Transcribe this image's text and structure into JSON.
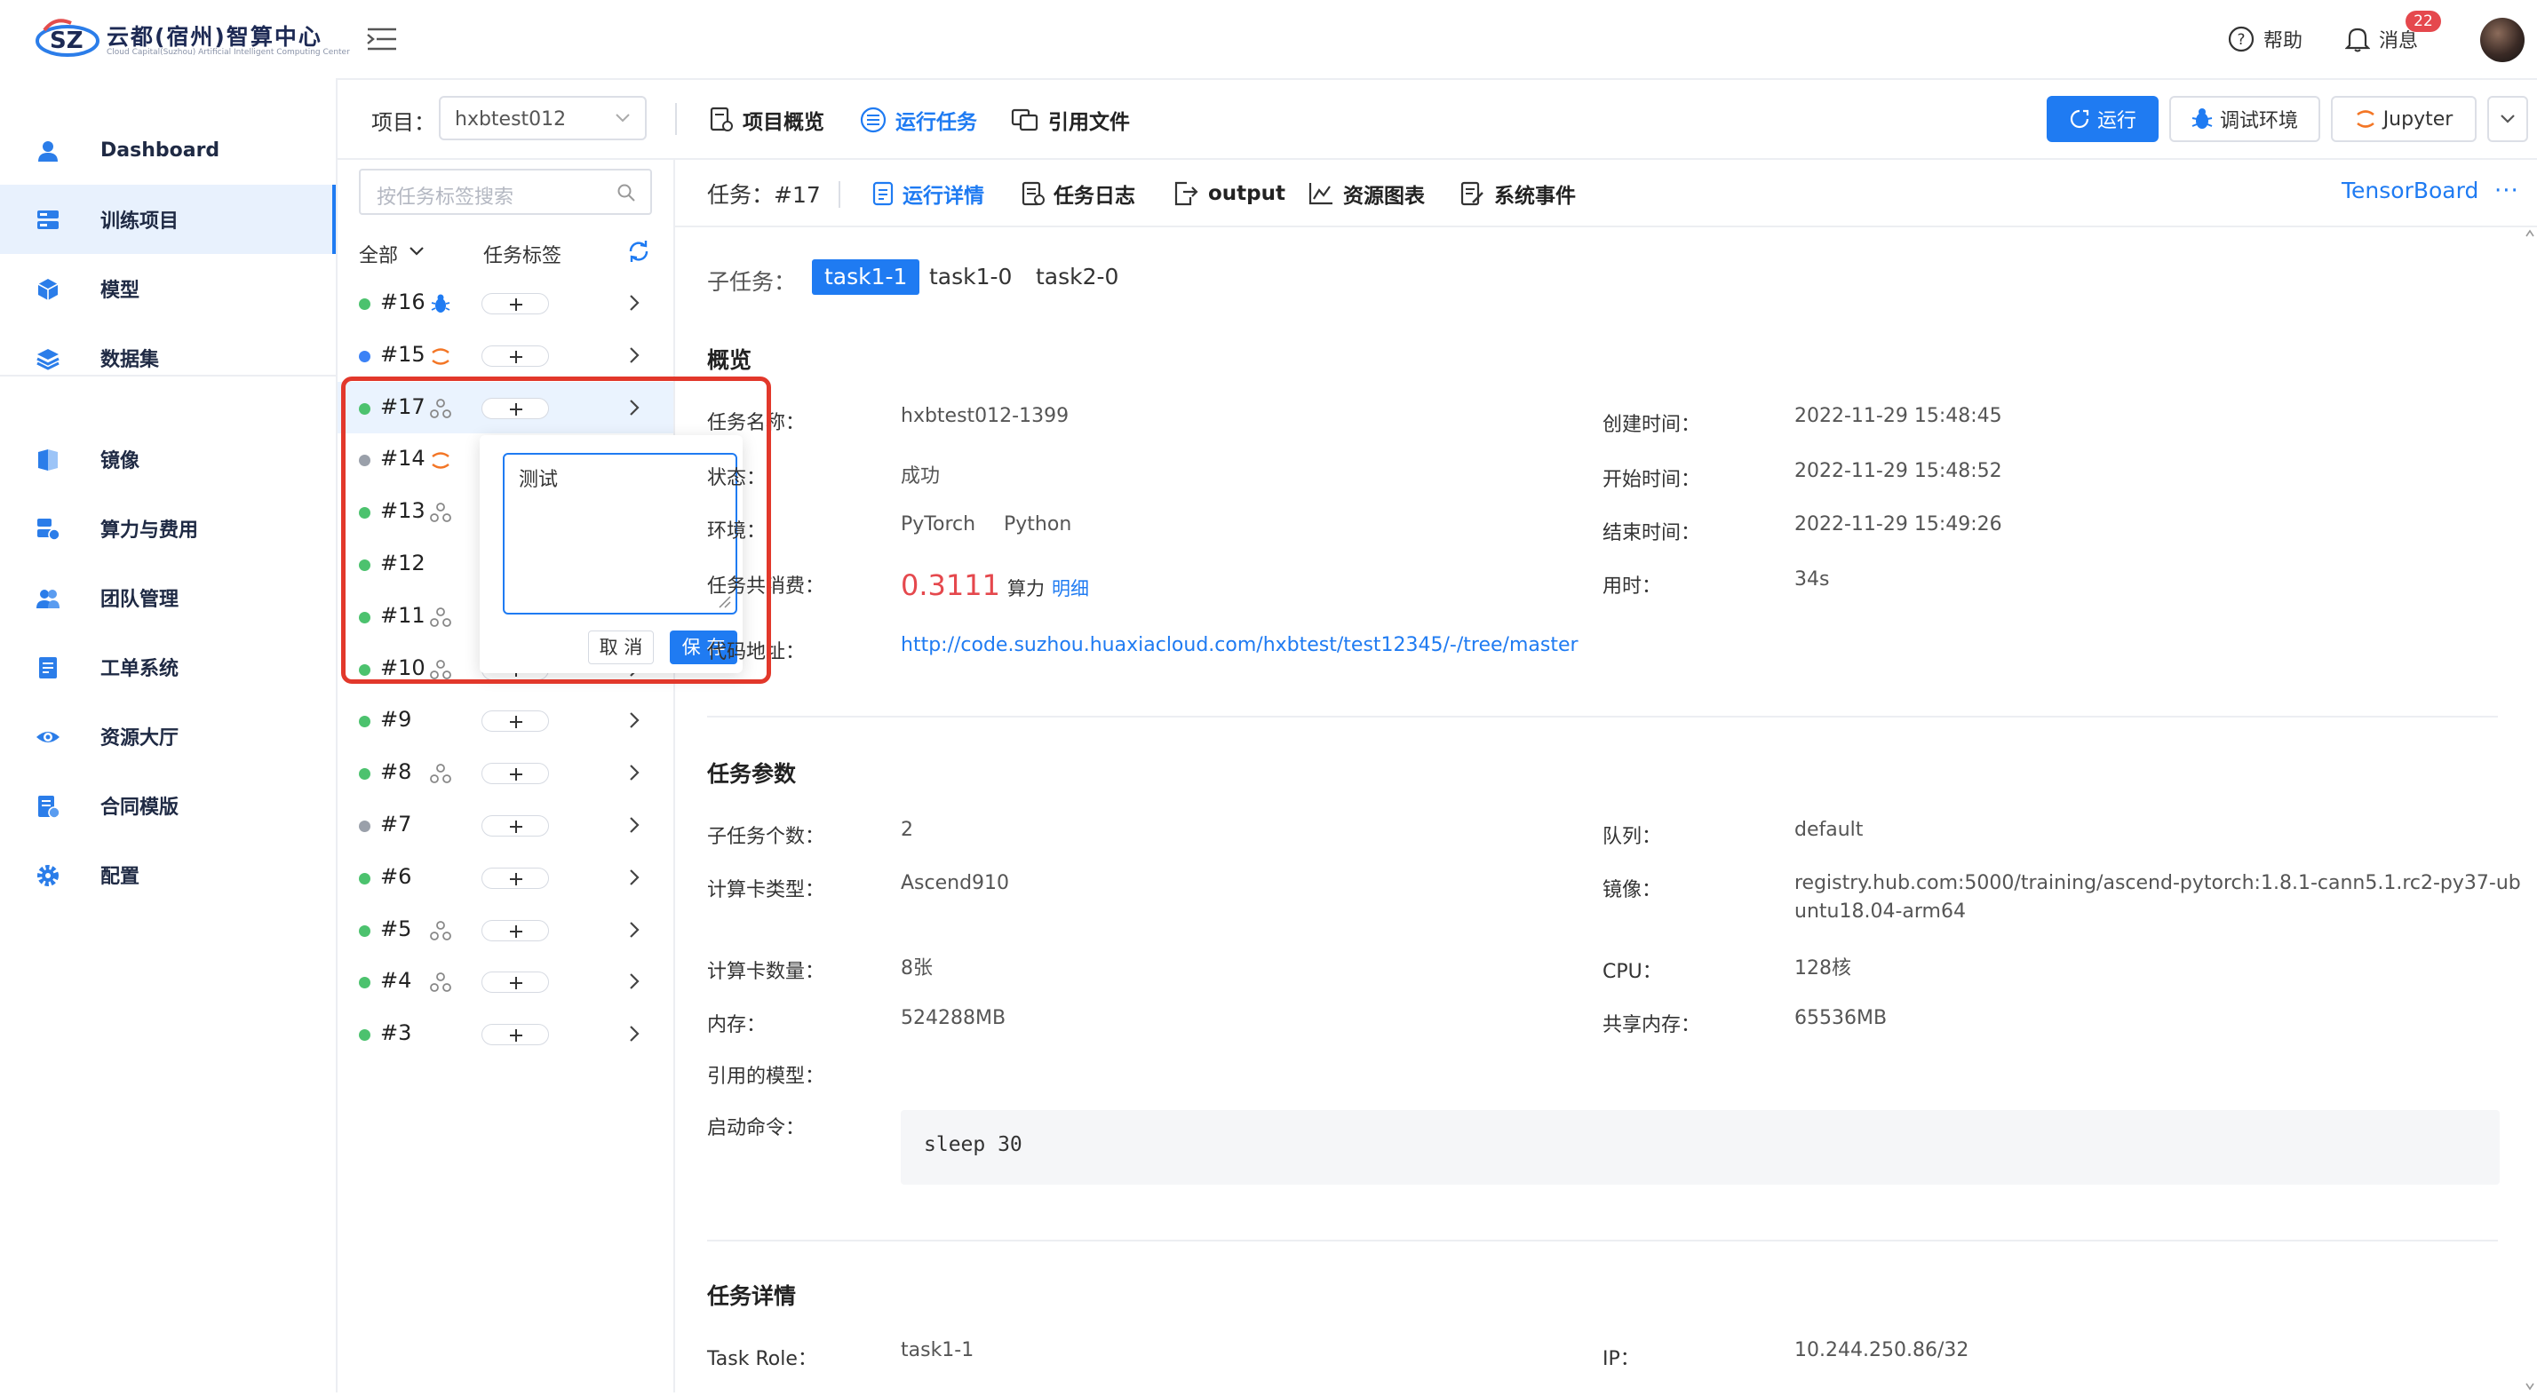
{
  "brand": {
    "name": "云都(宿州)智算中心",
    "subtitle": "Cloud Capital(Suzhou) Artificial Intelligent Computing Center"
  },
  "header": {
    "help": "帮助",
    "messages": "消息",
    "message_count": "22"
  },
  "sidebar": {
    "items": [
      {
        "label": "Dashboard",
        "icon": "user-icon"
      },
      {
        "label": "训练项目",
        "icon": "server-icon",
        "active": true
      },
      {
        "label": "模型",
        "icon": "cube-icon"
      },
      {
        "label": "数据集",
        "icon": "layers-icon"
      },
      {
        "label": "镜像",
        "icon": "mirror-icon"
      },
      {
        "label": "算力与费用",
        "icon": "compute-icon"
      },
      {
        "label": "团队管理",
        "icon": "team-icon"
      },
      {
        "label": "工单系统",
        "icon": "ticket-icon"
      },
      {
        "label": "资源大厅",
        "icon": "eye-icon"
      },
      {
        "label": "合同模版",
        "icon": "contract-icon"
      },
      {
        "label": "配置",
        "icon": "gear-icon"
      }
    ]
  },
  "project": {
    "label": "项目：",
    "selected": "hxbtest012",
    "tabs": [
      {
        "label": "项目概览",
        "icon": "overview-icon"
      },
      {
        "label": "运行任务",
        "icon": "list-icon",
        "active": true
      },
      {
        "label": "引用文件",
        "icon": "files-icon"
      }
    ],
    "actions": {
      "run": "运行",
      "debug_env": "调试环境",
      "jupyter": "Jupyter"
    }
  },
  "tasklist": {
    "search_placeholder": "按任务标签搜索",
    "filter": "全部",
    "tag_header": "任务标签",
    "rows": [
      {
        "id": "#16",
        "status": "green",
        "icon": "bug-icon"
      },
      {
        "id": "#15",
        "status": "blue",
        "icon": "jupyter-icon"
      },
      {
        "id": "#17",
        "status": "green",
        "icon": "distributed-icon",
        "active": true
      },
      {
        "id": "#14",
        "status": "gray",
        "icon": "jupyter-icon"
      },
      {
        "id": "#13",
        "status": "green",
        "icon": "distributed-icon"
      },
      {
        "id": "#12",
        "status": "green",
        "icon": ""
      },
      {
        "id": "#11",
        "status": "green",
        "icon": "distributed-icon"
      },
      {
        "id": "#10",
        "status": "green",
        "icon": "distributed-icon"
      },
      {
        "id": "#9",
        "status": "green",
        "icon": ""
      },
      {
        "id": "#8",
        "status": "green",
        "icon": "distributed-icon"
      },
      {
        "id": "#7",
        "status": "gray",
        "icon": ""
      },
      {
        "id": "#6",
        "status": "green",
        "icon": ""
      },
      {
        "id": "#5",
        "status": "green",
        "icon": "distributed-icon"
      },
      {
        "id": "#4",
        "status": "green",
        "icon": "distributed-icon"
      },
      {
        "id": "#3",
        "status": "green",
        "icon": ""
      }
    ]
  },
  "tag_popover": {
    "value": "测试",
    "cancel": "取 消",
    "save": "保 存"
  },
  "detail": {
    "task_label": "任务：#17",
    "tabs": [
      {
        "label": "运行详情",
        "icon": "detail-icon",
        "active": true
      },
      {
        "label": "任务日志",
        "icon": "log-icon"
      },
      {
        "label": "output",
        "icon": "output-icon"
      },
      {
        "label": "资源图表",
        "icon": "chart-icon"
      },
      {
        "label": "系统事件",
        "icon": "event-icon"
      }
    ],
    "tensorboard": "TensorBoard",
    "more": "···",
    "subtask_label": "子任务：",
    "subtasks": [
      "task1-1",
      "task1-0",
      "task2-0"
    ],
    "overview": {
      "title": "概览",
      "name_label": "任务名称：",
      "name": "hxbtest012-1399",
      "status_label": "状态：",
      "status": "成功",
      "env_label": "环境：",
      "env": [
        "PyTorch",
        "Python"
      ],
      "cost_label": "任务共消费：",
      "cost": "0.3111",
      "cost_unit": "算力",
      "cost_detail": "明细",
      "repo_label": "代码地址：",
      "repo": "http://code.suzhou.huaxiacloud.com/hxbtest/test12345/-/tree/master",
      "created_label": "创建时间：",
      "created": "2022-11-29 15:48:45",
      "started_label": "开始时间：",
      "started": "2022-11-29 15:48:52",
      "ended_label": "结束时间：",
      "ended": "2022-11-29 15:49:26",
      "duration_label": "用时：",
      "duration": "34s"
    },
    "params": {
      "title": "任务参数",
      "subtask_count_label": "子任务个数：",
      "subtask_count": "2",
      "card_type_label": "计算卡类型：",
      "card_type": "Ascend910",
      "card_count_label": "计算卡数量：",
      "card_count": "8张",
      "memory_label": "内存：",
      "memory": "524288MB",
      "model_label": "引用的模型：",
      "command_label": "启动命令：",
      "command": "sleep 30",
      "queue_label": "队列：",
      "queue": "default",
      "image_label": "镜像：",
      "image_line1": "registry.hub.com:5000/training/ascend-pytorch:1.8.1-cann5.1.rc2-py37-ub",
      "image_line2": "untu18.04-arm64",
      "cpu_label": "CPU：",
      "cpu": "128核",
      "shm_label": "共享内存：",
      "shm": "65536MB"
    },
    "task_detail": {
      "title": "任务详情",
      "role_label": "Task Role：",
      "role": "task1-1",
      "ip_label": "IP：",
      "ip": "10.244.250.86/32"
    }
  },
  "colors": {
    "primary": "#1f7bf2",
    "danger": "#e5484d",
    "status_green": "#4cc26e",
    "status_blue": "#3b82f6",
    "status_gray": "#9aa0aa",
    "highlight": "#e2382b"
  }
}
